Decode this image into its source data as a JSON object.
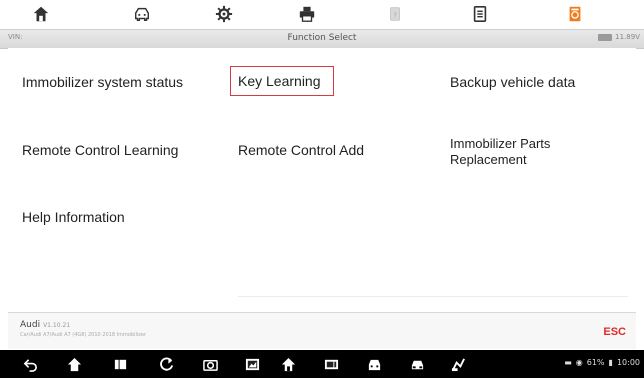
{
  "toolbar": {
    "icons": [
      "home-icon",
      "vehicle-icon",
      "settings-icon",
      "print-icon",
      "help-icon",
      "save-icon",
      "data-log-icon"
    ],
    "active_color": "#f07d1a"
  },
  "titlebar": {
    "left": "VIN:",
    "title": "Function Select",
    "voltage": "11.89V"
  },
  "functions": {
    "immobilizer_status": "Immobilizer system status",
    "key_learning": "Key Learning",
    "backup_vehicle_data": "Backup vehicle data",
    "remote_control_learning": "Remote Control Learning",
    "remote_control_add": "Remote Control Add",
    "immobilizer_parts_line1": "Immobilizer Parts",
    "immobilizer_parts_line2": "Replacement",
    "help_information": "Help Information"
  },
  "footer": {
    "brand": "Audi",
    "brand_sub": "V1.10.21",
    "path": "Car/Audi A7/Audi A7 (4G8) 2010 2018 Immobilizer",
    "esc": "ESC",
    "esc_color": "#e02a2a"
  },
  "navbar": {
    "icons": [
      "back-icon",
      "home-icon",
      "recent-apps-icon",
      "refresh-icon",
      "camera-icon",
      "screenshot-icon",
      "autel-home-icon",
      "vci-icon",
      "car-ops-icon",
      "car-icon",
      "share-icon"
    ],
    "status_battery": "61%",
    "status_time": "10:00"
  },
  "colors": {
    "accent_red": "#d43c43",
    "title_gradient_top": "#e9e9e9"
  }
}
